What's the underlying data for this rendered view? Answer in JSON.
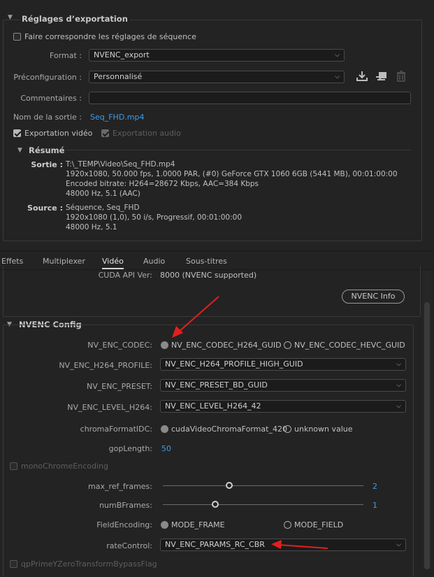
{
  "colors": {
    "background": "#232323",
    "accent": "#3d9bea",
    "arrow": "#e0201f"
  },
  "export_settings": {
    "title": "Réglages d’exportation",
    "match_sequence": "Faire correspondre les réglages de séquence",
    "format_label": "Format :",
    "format_value": "NVENC_export",
    "preset_label": "Préconfiguration :",
    "preset_value": "Personnalisé",
    "comments_label": "Commentaires :",
    "comments_value": "",
    "output_label": "Nom de la sortie :",
    "output_value": "Seq_FHD.mp4",
    "export_video": "Exportation vidéo",
    "export_audio": "Exportation audio",
    "icons": [
      "save-preset-icon",
      "import-preset-icon",
      "delete-preset-icon"
    ]
  },
  "summary": {
    "title": "Résumé",
    "output_label": "Sortie :",
    "output_lines": [
      "T:\\_TEMP\\Video\\Seq_FHD.mp4",
      "1920x1080, 50.000 fps, 1.0000 PAR, (#0) GeForce GTX 1060 6GB (5441 MB), 00:01:00:00",
      "Encoded bitrate: H264=28672 Kbps, AAC=384 Kbps",
      "48000 Hz, 5.1 (AAC)"
    ],
    "source_label": "Source :",
    "source_lines": [
      "Séquence, Seq_FHD",
      "1920x1080 (1,0), 50  i/s, Progressif, 00:01:00:00",
      "48000 Hz, 5.1"
    ]
  },
  "tabs": [
    "Effets",
    "Multiplexer",
    "Vidéo",
    "Audio",
    "Sous-titres"
  ],
  "active_tab": "Vidéo",
  "cuda": {
    "label": "CUDA API Ver:",
    "value": "8000 (NVENC supported)",
    "info_button": "NVENC Info"
  },
  "nvenc": {
    "title": "NVENC Config",
    "codec_label": "NV_ENC_CODEC:",
    "codec_opt1": "NV_ENC_CODEC_H264_GUID",
    "codec_opt2": "NV_ENC_CODEC_HEVC_GUID",
    "codec_selected": "NV_ENC_CODEC_H264_GUID",
    "profile_label": "NV_ENC_H264_PROFILE:",
    "profile_value": "NV_ENC_H264_PROFILE_HIGH_GUID",
    "preset_label": "NV_ENC_PRESET:",
    "preset_value": "NV_ENC_PRESET_BD_GUID",
    "level_label": "NV_ENC_LEVEL_H264:",
    "level_value": "NV_ENC_LEVEL_H264_42",
    "chroma_label": "chromaFormatIDC:",
    "chroma_opt1": "cudaVideoChromaFormat_420",
    "chroma_opt2": "unknown value",
    "chroma_selected": "cudaVideoChromaFormat_420",
    "gop_label": "gopLength:",
    "gop_value": "50",
    "mono_label": "monoChromeEncoding",
    "maxref_label": "max_ref_frames:",
    "maxref_value": "2",
    "maxref_fraction": 0.33,
    "bframes_label": "numBFrames:",
    "bframes_value": "1",
    "bframes_fraction": 0.26,
    "field_label": "FieldEncoding:",
    "field_opt1": "MODE_FRAME",
    "field_opt2": "MODE_FIELD",
    "field_selected": "MODE_FRAME",
    "rate_label": "rateControl:",
    "rate_value": "NV_ENC_PARAMS_RC_CBR",
    "bottom_cut_label": "qpPrimeYZeroTransformBypassFlag"
  }
}
